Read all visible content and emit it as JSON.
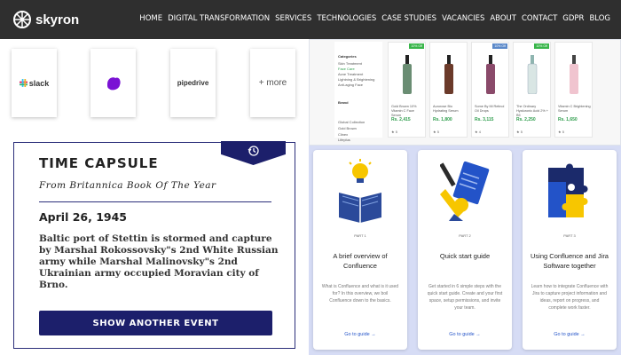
{
  "header": {
    "brand": "skyron",
    "nav": [
      "HOME",
      "DIGITAL TRANSFORMATION",
      "SERVICES",
      "TECHNOLOGIES",
      "CASE STUDIES",
      "VACANCIES",
      "ABOUT",
      "CONTACT",
      "GDPR",
      "BLOG"
    ]
  },
  "integrations": {
    "items": [
      {
        "label": "slack",
        "icon": "slack-logo",
        "color": "#1d1c1d"
      },
      {
        "label": "",
        "icon": "purple-blob-logo",
        "color": "#7a12d4"
      },
      {
        "label": "pipedrive",
        "icon": "pipedrive-logo",
        "color": "#26292c"
      },
      {
        "label": "+ more",
        "icon": "",
        "color": "#555555"
      }
    ]
  },
  "time_capsule": {
    "title": "TIME CAPSULE",
    "subtitle": "From Britannica Book Of The Year",
    "date": "April 26, 1945",
    "body": "Baltic port of Stettin is stormed and capture by Marshal Rokossovsky\"s 2nd White Russian army while Marshal Malinovsky\"s 2nd Ukrainian army occupied Moravian city of Brno.",
    "button": "SHOW ANOTHER EVENT",
    "badge_icon": "history-clock-icon",
    "accent": "#1c1f6b"
  },
  "shop": {
    "filters": [
      "Categories",
      "Skin Treatment",
      "Face Care",
      "Acne Treatment",
      "Lightning & Brightening",
      "Anti-aging Face",
      "Brand",
      "Global Collection",
      "Gold Brown",
      "Clinex",
      "Lifeplus"
    ],
    "products": [
      {
        "badge": "10% Off",
        "name": "Gold Brown 10% Vitamin C Face Serum",
        "price": "Rs. 2,415",
        "foot": "★ 5",
        "bottle": "#6a8d73"
      },
      {
        "badge": "",
        "name": "Aurorose Bio Hydrating Serum",
        "price": "Rs. 1,800",
        "foot": "★ 5",
        "bottle": "#6b3a2a"
      },
      {
        "badge": "10% Off",
        "name": "Some By Mi Retinol Oil Drops",
        "price": "Rs. 3,115",
        "foot": "★ 4",
        "bottle": "#8a4a6a"
      },
      {
        "badge": "10% Off",
        "name": "The Ordinary Hyaluronic Acid 2% + B5",
        "price": "Rs. 2,250",
        "foot": "★ 5",
        "bottle": "#d9e6e4"
      },
      {
        "badge": "",
        "name": "Vitamin C Brightening Serum",
        "price": "Rs. 1,650",
        "foot": "★ 5",
        "bottle": "#f0c4cf"
      }
    ]
  },
  "guides": [
    {
      "part": "PART 1",
      "title": "A brief overview of Confluence",
      "text": "What is Confluence and what is it used for? In this overview, we boil Confluence down to the basics.",
      "link": "Go to guide →",
      "icon": "book-bulb-icon"
    },
    {
      "part": "PART 2",
      "title": "Quick start guide",
      "text": "Get started in 6 simple steps with the quick start guide. Create and your first space, setup permissions, and invite your team.",
      "link": "Go to guide →",
      "icon": "quick-start-icon"
    },
    {
      "part": "PART 3",
      "title": "Using Confluence and Jira Software together",
      "text": "Learn how to integrate Confluence with Jira to capture project information and ideas, report on progress, and complete work faster.",
      "link": "Go to guide →",
      "icon": "puzzle-icon"
    }
  ]
}
